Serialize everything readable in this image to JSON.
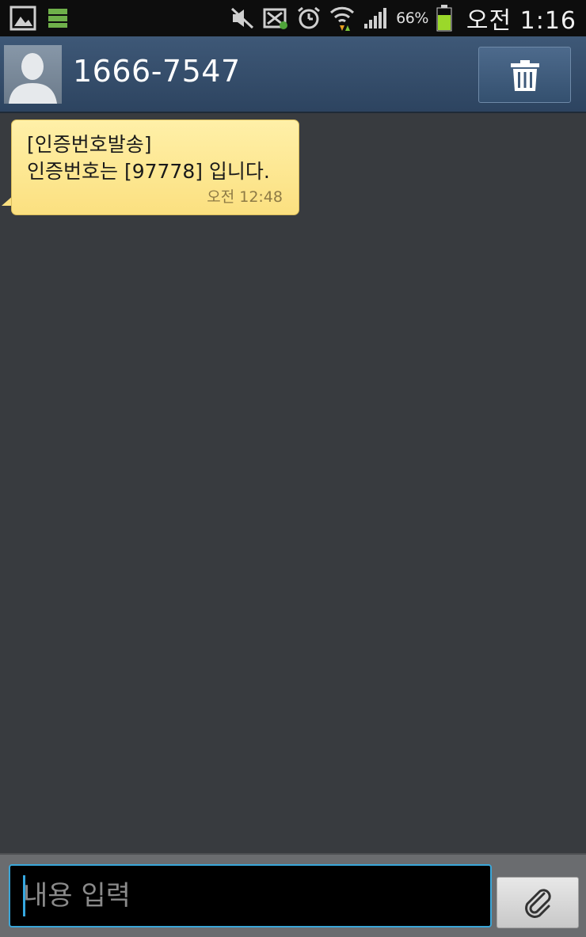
{
  "status_bar": {
    "left_icons": [
      "gallery-icon",
      "storage-icon"
    ],
    "right_icons": [
      "mute-icon",
      "cross-app-icon",
      "alarm-icon",
      "wifi-icon",
      "signal-icon"
    ],
    "battery_percent": "66%",
    "time": "오전 1:16",
    "battery_color": "#9bd82a"
  },
  "header": {
    "contact_name": "1666-7547",
    "avatar_icon": "person-silhouette-icon",
    "delete_icon": "trash-icon"
  },
  "messages": [
    {
      "line1": "[인증번호발송]",
      "line2": "인증번호는 [97778] 입니다.",
      "time": "오전 12:48",
      "bubble_color": "#fbe080"
    }
  ],
  "composer": {
    "placeholder": "내용 입력",
    "attach_icon": "paperclip-icon",
    "accent": "#3aa6d8"
  }
}
